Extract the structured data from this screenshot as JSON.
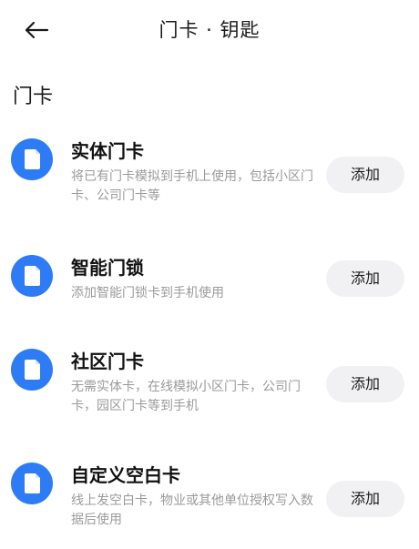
{
  "header": {
    "title": "门卡 · 钥匙",
    "back_icon": "back-arrow-icon"
  },
  "section": {
    "title": "门卡"
  },
  "colors": {
    "accent": "#2d7cf6",
    "button_bg": "#f1f1f3",
    "desc_text": "#9a9a9a"
  },
  "items": [
    {
      "title": "实体门卡",
      "desc": "将已有门卡模拟到手机上使用，包括小区门卡、公司门卡等",
      "button": "添加",
      "icon": "card-icon"
    },
    {
      "title": "智能门锁",
      "desc": "添加智能门锁卡到手机使用",
      "button": "添加",
      "icon": "card-icon"
    },
    {
      "title": "社区门卡",
      "desc": "无需实体卡，在线模拟小区门卡，公司门卡，园区门卡等到手机",
      "button": "添加",
      "icon": "card-icon"
    },
    {
      "title": "自定义空白卡",
      "desc": "线上发空白卡，物业或其他单位授权写入数据后使用",
      "button": "添加",
      "icon": "card-icon"
    }
  ]
}
